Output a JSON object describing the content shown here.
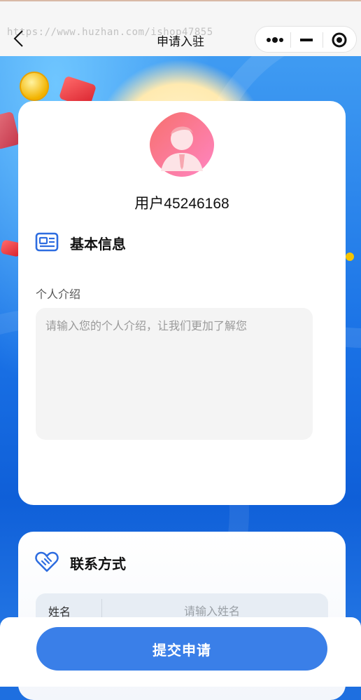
{
  "nav": {
    "title": "申请入驻",
    "watermark": "https://www.huzhan.com/ishop47855"
  },
  "profile": {
    "username": "用户45246168"
  },
  "basic_info": {
    "title": "基本信息",
    "intro_label": "个人介绍",
    "intro_placeholder": "请输入您的个人介绍，让我们更加了解您",
    "intro_value": ""
  },
  "contact": {
    "title": "联系方式",
    "name_label": "姓名",
    "name_placeholder": "请输入姓名"
  },
  "footer": {
    "submit_label": "提交申请"
  },
  "colors": {
    "primary": "#3a7fe8",
    "background_blue": "#1a72e6",
    "avatar_gradient_start": "#f7706d",
    "avatar_gradient_end": "#ff85c2"
  }
}
